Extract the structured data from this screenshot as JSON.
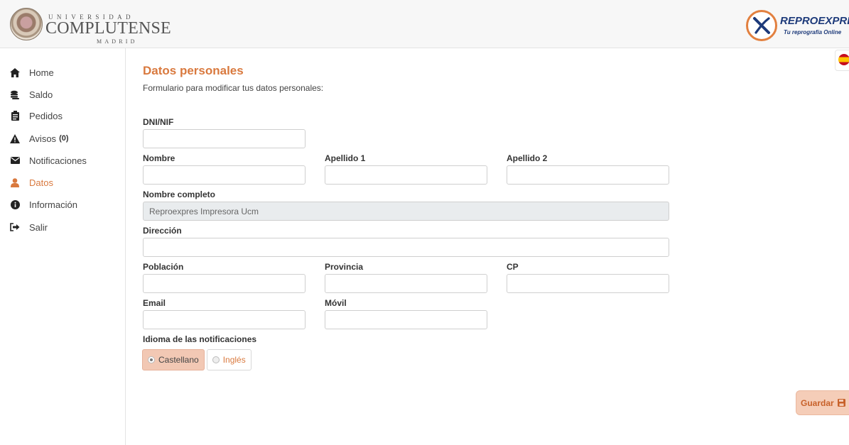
{
  "header": {
    "ucm_logo": {
      "line1": "UNIVERSIDAD",
      "line2": "COMPLUTENSE",
      "line3": "MADRID"
    },
    "reproexpres_logo": {
      "name": "REPROEXPRES",
      "tagline": "Tu reprografía Online"
    },
    "language_flag": "flag-spain-icon"
  },
  "sidebar": {
    "items": [
      {
        "label": "Home",
        "icon": "home-icon"
      },
      {
        "label": "Saldo",
        "icon": "coins-icon"
      },
      {
        "label": "Pedidos",
        "icon": "clipboard-icon"
      },
      {
        "label": "Avisos",
        "icon": "warning-icon",
        "count": "(0)"
      },
      {
        "label": "Notificaciones",
        "icon": "envelope-icon"
      },
      {
        "label": "Datos",
        "icon": "user-icon",
        "active": true
      },
      {
        "label": "Información",
        "icon": "info-icon"
      },
      {
        "label": "Salir",
        "icon": "sign-out-icon"
      }
    ]
  },
  "main": {
    "title": "Datos personales",
    "subtitle": "Formulario para modificar tus datos personales:"
  },
  "form": {
    "dni": {
      "label": "DNI/NIF",
      "value": ""
    },
    "nombre": {
      "label": "Nombre",
      "value": ""
    },
    "apellido1": {
      "label": "Apellido 1",
      "value": ""
    },
    "apellido2": {
      "label": "Apellido 2",
      "value": ""
    },
    "nombre_completo": {
      "label": "Nombre completo",
      "value": "Reproexpres Impresora Ucm"
    },
    "direccion": {
      "label": "Dirección",
      "value": ""
    },
    "poblacion": {
      "label": "Población",
      "value": ""
    },
    "provincia": {
      "label": "Provincia",
      "value": ""
    },
    "cp": {
      "label": "CP",
      "value": ""
    },
    "email": {
      "label": "Email",
      "value": ""
    },
    "movil": {
      "label": "Móvil",
      "value": ""
    },
    "idioma": {
      "label": "Idioma de las notificaciones",
      "options": [
        "Castellano",
        "Inglés"
      ],
      "selected": "Castellano"
    },
    "save_label": "Guardar"
  },
  "colors": {
    "accent": "#d9793e",
    "brand_blue": "#1d3a7a",
    "header_bg": "#f7f7f7"
  }
}
